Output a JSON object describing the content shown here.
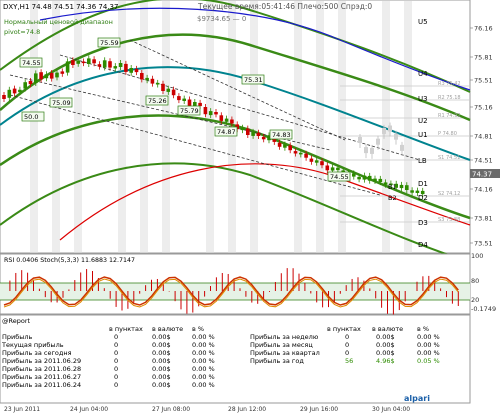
{
  "window": {
    "symbol_line": "DXY,H1  74.48 74.51 74.36 74.37",
    "server_time": "Текущее время:05:41:46 Плечо:500 Спрэд:0",
    "balance_line": "$9734.65 — 0",
    "pivot_title": "Нормальный ценовой диапазон",
    "pivot_value": "pivot=74.8"
  },
  "price_axis": [
    "76.16",
    "75.81",
    "75.51",
    "75.16",
    "74.81",
    "74.51",
    "74.16",
    "73.81",
    "73.51"
  ],
  "current_price": "74.37",
  "level_labels": {
    "right": [
      "U5",
      "U4",
      "U3",
      "U2",
      "U1",
      "LB",
      "D1",
      "D2",
      "D3",
      "D4"
    ],
    "left": [
      "B1",
      "B2"
    ],
    "values": [
      "R3 75.42",
      "R2 75.18",
      "R1 74.92",
      "P 74.80",
      "S1 74.51",
      "S2 74.12",
      "S3 73.88"
    ]
  },
  "price_boxes": [
    "75.59",
    "75.26",
    "75.79",
    "75.09",
    "75.31",
    "74.87",
    "74.83",
    "74.55",
    "74.55",
    "50.0"
  ],
  "oscillator": {
    "title": "RSI 0.0406  Stoch(5,3,3) 11.6883 12.7147",
    "axis": [
      "100",
      "80",
      "20",
      "-0.1749"
    ]
  },
  "report": {
    "header": "@Report",
    "col_headers": [
      "в пунктах",
      "в валюте",
      "в %"
    ],
    "left_rows": [
      {
        "label": "Прибыль",
        "points": "0",
        "money": "0.00$",
        "pct": "0.00 %"
      },
      {
        "label": "Текущая прибыль",
        "points": "0",
        "money": "0.00$",
        "pct": "0.00 %"
      },
      {
        "label": "Прибыль за сегодня",
        "points": "0",
        "money": "0.00$",
        "pct": "0.00 %"
      },
      {
        "label": "Прибыль за 2011.06.29",
        "points": "0",
        "money": "0.00$",
        "pct": "0.00 %"
      },
      {
        "label": "Прибыль за 2011.06.28",
        "points": "0",
        "money": "0.00$",
        "pct": "0.00 %"
      },
      {
        "label": "Прибыль за 2011.06.27",
        "points": "0",
        "money": "0.00$",
        "pct": "0.00 %"
      },
      {
        "label": "Прибыль за 2011.06.24",
        "points": "0",
        "money": "0.00$",
        "pct": "0.00 %"
      }
    ],
    "right_rows": [
      {
        "label": "Прибыль за неделю",
        "points": "0",
        "money": "0.00$",
        "pct": "0.00 %"
      },
      {
        "label": "Прибыль за месяц",
        "points": "0",
        "money": "0.00$",
        "pct": "0.00 %"
      },
      {
        "label": "Прибыль за квартал",
        "points": "0",
        "money": "0.00$",
        "pct": "0.00 %"
      },
      {
        "label": "Прибыль за год",
        "points": "56",
        "money": "4.96$",
        "pct": "0.05 %"
      }
    ]
  },
  "time_axis": [
    "23 Jun 2011",
    "24 Jun 04:00",
    "27 Jun 08:00",
    "28 Jun 12:00",
    "29 Jun 16:00",
    "30 Jun 04:00"
  ],
  "broker": "alpari",
  "colors": {
    "up_candle": "#2d8b00",
    "down_candle": "#cc0000",
    "green_band": "#3a8a16",
    "blue_band": "#0000cc",
    "teal_band": "#00838f",
    "red_band": "#dd0000",
    "current_price_tag": "#6b6b6b"
  }
}
